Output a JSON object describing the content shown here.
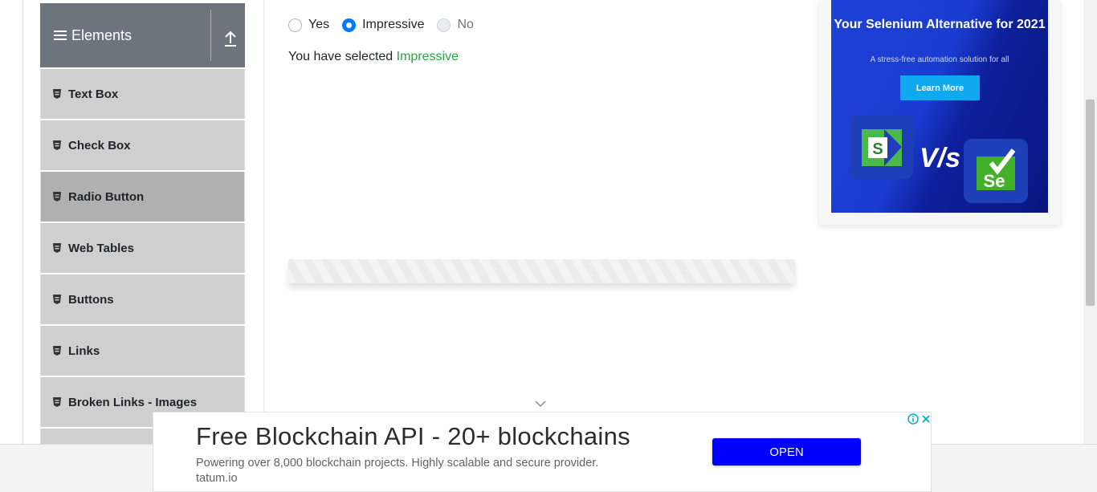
{
  "sidebar": {
    "group_title": "Elements",
    "items": [
      {
        "label": "Text Box"
      },
      {
        "label": "Check Box"
      },
      {
        "label": "Radio Button",
        "active": true
      },
      {
        "label": "Web Tables"
      },
      {
        "label": "Buttons"
      },
      {
        "label": "Links"
      },
      {
        "label": "Broken Links - Images"
      }
    ]
  },
  "radio_group": {
    "options": [
      {
        "label": "Yes",
        "checked": false,
        "disabled": false
      },
      {
        "label": "Impressive",
        "checked": true,
        "disabled": false
      },
      {
        "label": "No",
        "checked": false,
        "disabled": true
      }
    ],
    "result_prefix": "You have selected ",
    "result_value": "Impressive"
  },
  "side_ad": {
    "title": "Your Selenium Alternative for 2021",
    "subtitle": "A stress-free automation solution for all",
    "cta": "Learn More",
    "vs_text": "V/s"
  },
  "bottom_ad": {
    "title": "Free Blockchain API - 20+ blockchains",
    "description": "Powering over 8,000 blockchain projects. Highly scalable and secure provider.",
    "domain": "tatum.io",
    "cta": "OPEN"
  },
  "colors": {
    "accent": "#007bff",
    "success": "#28a745",
    "sidebar_header": "#6c757d",
    "ad_cta": "#0000ff"
  }
}
